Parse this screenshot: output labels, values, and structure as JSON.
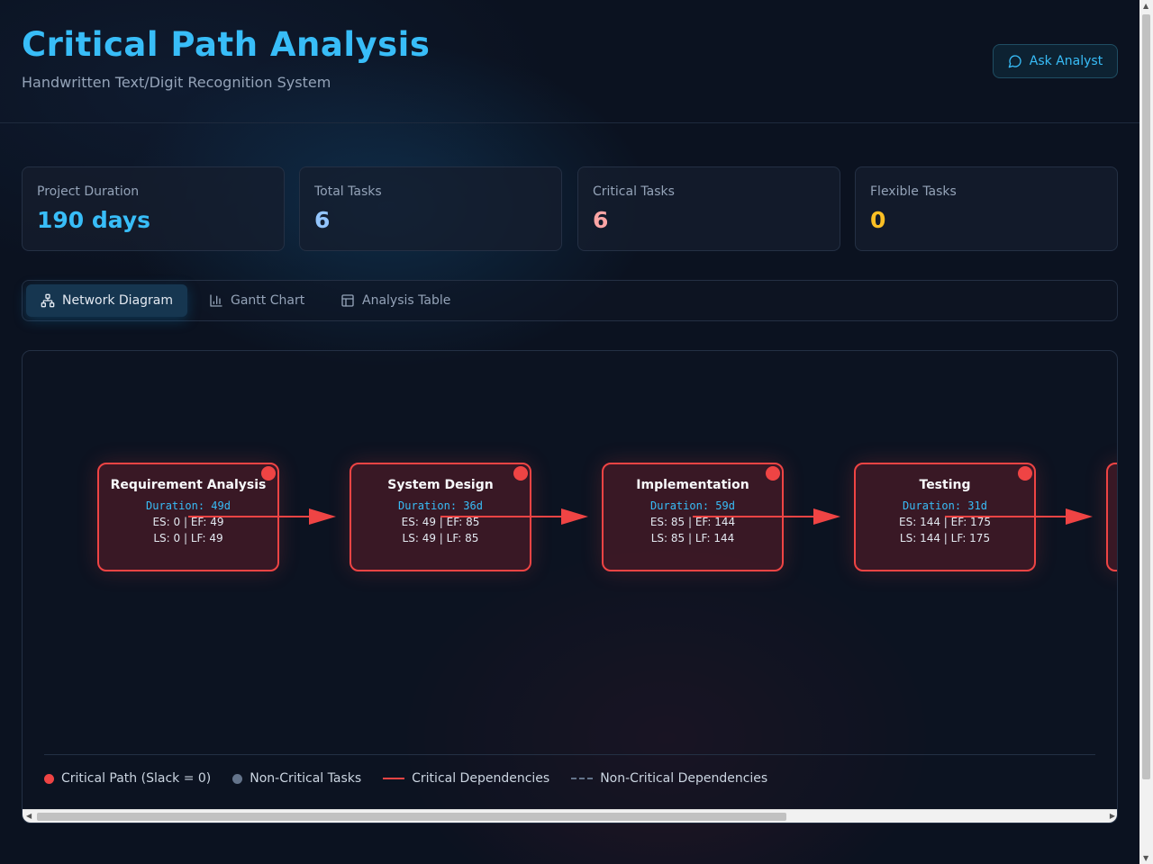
{
  "header": {
    "title": "Critical Path Analysis",
    "subtitle": "Handwritten Text/Digit Recognition System",
    "ask_label": "Ask Analyst"
  },
  "stats": [
    {
      "label": "Project Duration",
      "value": "190 days",
      "color": "#38bdf8"
    },
    {
      "label": "Total Tasks",
      "value": "6",
      "color": "#93c5fd"
    },
    {
      "label": "Critical Tasks",
      "value": "6",
      "color": "#fca5a5"
    },
    {
      "label": "Flexible Tasks",
      "value": "0",
      "color": "#fbbf24"
    }
  ],
  "tabs": [
    {
      "label": "Network Diagram",
      "icon": "network-icon",
      "active": true
    },
    {
      "label": "Gantt Chart",
      "icon": "bar-chart-icon",
      "active": false
    },
    {
      "label": "Analysis Table",
      "icon": "table-icon",
      "active": false
    }
  ],
  "nodes": [
    {
      "name": "Requirement Analysis",
      "duration": "Duration: 49d",
      "es_ef": "ES: 0 | EF: 49",
      "ls_lf": "LS: 0 | LF: 49"
    },
    {
      "name": "System Design",
      "duration": "Duration: 36d",
      "es_ef": "ES: 49 | EF: 85",
      "ls_lf": "LS: 49 | LF: 85"
    },
    {
      "name": "Implementation",
      "duration": "Duration: 59d",
      "es_ef": "ES: 85 | EF: 144",
      "ls_lf": "LS: 85 | LF: 144"
    },
    {
      "name": "Testing",
      "duration": "Duration: 31d",
      "es_ef": "ES: 144 | EF: 175",
      "ls_lf": "LS: 144 | LF: 175"
    }
  ],
  "legend": {
    "critical_path": "Critical Path (Slack = 0)",
    "non_critical_tasks": "Non-Critical Tasks",
    "critical_deps": "Critical Dependencies",
    "non_critical_deps": "Non-Critical Dependencies"
  },
  "colors": {
    "accent": "#38bdf8",
    "critical": "#ef4444",
    "non_critical": "#64748b"
  }
}
